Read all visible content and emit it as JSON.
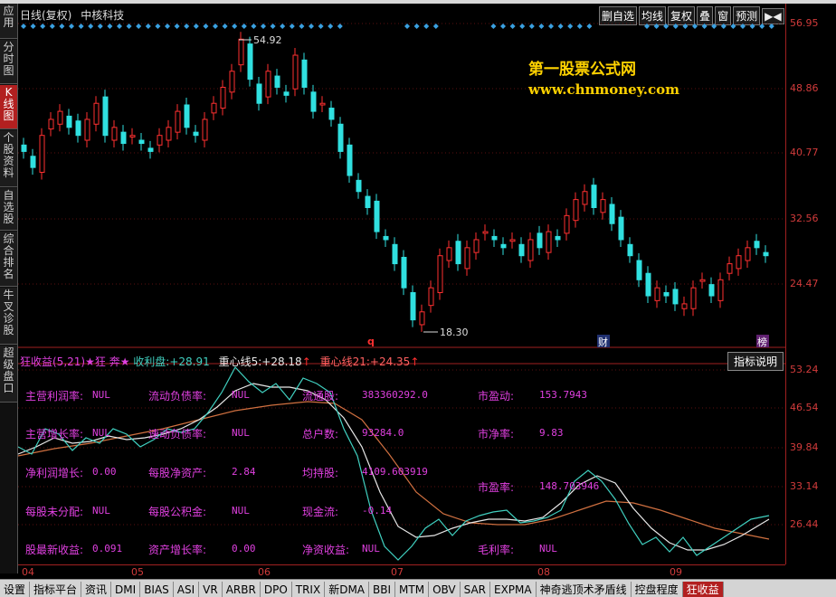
{
  "app": {
    "title_prefix": "日线(复权)",
    "stock_name": "中核科技"
  },
  "toolbar": [
    "删自选",
    "均线",
    "复权",
    "叠",
    "窗",
    "预测"
  ],
  "toolbar_arrows": "▶◀",
  "left_nav": [
    {
      "label": "应用",
      "active": false
    },
    {
      "label": "分时图",
      "active": false
    },
    {
      "label": "K线图",
      "active": true
    },
    {
      "label": "个股资料",
      "active": false
    },
    {
      "label": "自选股",
      "active": false
    },
    {
      "label": "综合排名",
      "active": false
    },
    {
      "label": "牛叉诊股",
      "active": false
    },
    {
      "label": "超级盘口",
      "active": false
    }
  ],
  "price_axis": [
    "56.95",
    "48.86",
    "40.77",
    "32.56",
    "24.47"
  ],
  "indicator_axis": [
    "53.24",
    "46.54",
    "39.84",
    "33.14",
    "26.44"
  ],
  "x_axis": [
    "04",
    "05",
    "06",
    "07",
    "08",
    "09"
  ],
  "annotations": {
    "high": "54.92",
    "low": "18.30",
    "mark_q": "q",
    "mark_cai": "财",
    "mark_bang": "榜"
  },
  "watermark": {
    "line1": "第一股票公式网",
    "line2": "www.chnmoney.com"
  },
  "indicator": {
    "name": "狂收益(5,21)",
    "star1": "★狂",
    "star2": "奔★",
    "lbl1": "收利盘:",
    "val1": "+28.91",
    "lbl2": "重心线5:",
    "val2": "+28.18",
    "lbl3": "重心线21:",
    "val3": "+24.35",
    "help": "指标说明"
  },
  "fundamentals": [
    {
      "label": "主营利润率:",
      "value": "NUL"
    },
    {
      "label": "流动负债率:",
      "value": "NUL"
    },
    {
      "label": "流通股:",
      "value": "383360292.0"
    },
    {
      "label": "市盈动:",
      "value": "153.7943"
    },
    {
      "label": "主营增长率:",
      "value": "NUL"
    },
    {
      "label": "速动负债率:",
      "value": "NUL"
    },
    {
      "label": "总户数:",
      "value": "93284.0"
    },
    {
      "label": "市净率:",
      "value": "9.83"
    },
    {
      "label": "净利润增长:",
      "value": "0.00"
    },
    {
      "label": "每股净资产:",
      "value": "2.84"
    },
    {
      "label": "均持股:",
      "value": "4109.603919"
    },
    {
      "label": "市盈率:",
      "value": "148.703946"
    },
    {
      "label": "每股未分配:",
      "value": "NUL"
    },
    {
      "label": "每股公积金:",
      "value": "NUL"
    },
    {
      "label": "现金流:",
      "value": "-0.14"
    },
    {
      "label": "股最新收益:",
      "value": "0.091"
    },
    {
      "label": "资产增长率:",
      "value": "0.00"
    },
    {
      "label": "净资收益:",
      "value": "NUL"
    },
    {
      "label": "毛利率:",
      "value": "NUL"
    }
  ],
  "bottom_tabs": [
    "设置",
    "指标平台",
    "资讯",
    "DMI",
    "BIAS",
    "ASI",
    "VR",
    "ARBR",
    "DPO",
    "TRIX",
    "新DMA",
    "BBI",
    "MTM",
    "OBV",
    "SAR",
    "EXPMA",
    "神奇逃顶术矛盾线",
    "控盘程度",
    "狂收益"
  ],
  "bottom_active": "狂收益",
  "colors": {
    "up": "#ff3030",
    "down": "#30e0e0",
    "axis": "#a02020",
    "line_white": "#e8e8e8",
    "line_cyan": "#40d0c0",
    "line_orange": "#d07040"
  }
}
